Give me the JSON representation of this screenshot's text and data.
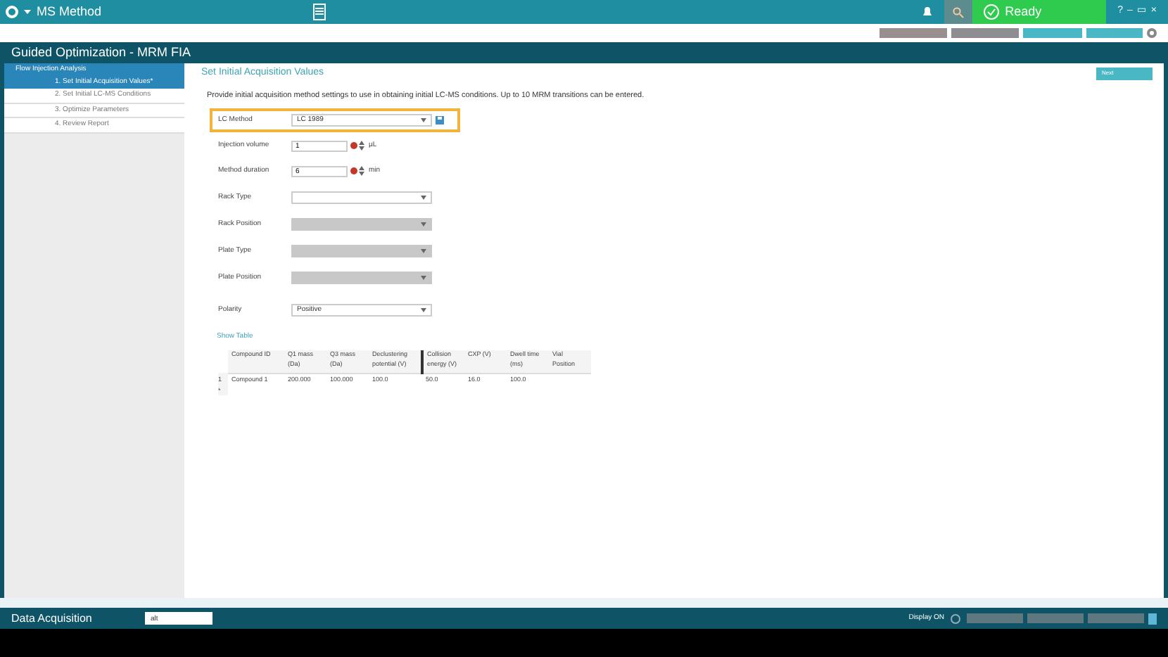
{
  "app_bar": {
    "title": "MS Method",
    "status": "Ready",
    "window_buttons": [
      "?",
      "–",
      "▭",
      "×"
    ]
  },
  "window": {
    "title": "Guided Optimization - MRM FIA"
  },
  "sidebar": {
    "header": "Flow Injection Analysis",
    "items": [
      {
        "label": "1. Set Initial Acquisition Values*",
        "selected": true
      },
      {
        "label": "2. Set Initial LC-MS Conditions",
        "selected": false
      },
      {
        "label": "3. Optimize Parameters",
        "selected": false
      },
      {
        "label": "4. Review Report",
        "selected": false
      }
    ]
  },
  "page": {
    "heading": "Set Initial Acquisition Values",
    "next": "Next",
    "intro": "Provide initial acquisition method settings to use in obtaining initial LC-MS conditions. Up to 10 MRM transitions can be entered.",
    "fields": [
      {
        "kind": "select",
        "label": "LC Method",
        "value": "LC 1989",
        "highlighted": true,
        "disabled": false
      },
      {
        "kind": "number",
        "label": "Injection volume",
        "value": "1",
        "unit": "µL"
      },
      {
        "kind": "number",
        "label": "Method duration",
        "value": "6",
        "unit": "min"
      },
      {
        "kind": "select",
        "label": "Rack Type",
        "highlighted": false,
        "disabled": false
      },
      {
        "kind": "select",
        "label": "Rack Position",
        "highlighted": false,
        "disabled": true
      },
      {
        "kind": "select",
        "label": "Plate Type",
        "highlighted": false,
        "disabled": true
      },
      {
        "kind": "select",
        "label": "Plate Position",
        "highlighted": false,
        "disabled": true
      },
      {
        "kind": "select",
        "label": "Polarity",
        "value": "Positive",
        "highlighted": false,
        "disabled": false
      }
    ],
    "table_link": "Show Table",
    "table": {
      "columns": [
        "Compound ID",
        "Q1 mass (Da)",
        "Q3 mass (Da)",
        "Declustering potential (V)",
        "Collision energy (V)",
        "CXP (V)",
        "Dwell time (ms)",
        "Vial Position"
      ],
      "rows": [
        {
          "marker": "1",
          "cells": [
            "Compound 1",
            "200.000",
            "100.000",
            "100.0",
            "50.0",
            "16.0",
            "100.0",
            ""
          ]
        },
        {
          "marker": "*",
          "cells": []
        }
      ]
    }
  },
  "status_bar": {
    "title": "Data Acquisition",
    "input": "alt",
    "mode": "Display ON"
  }
}
